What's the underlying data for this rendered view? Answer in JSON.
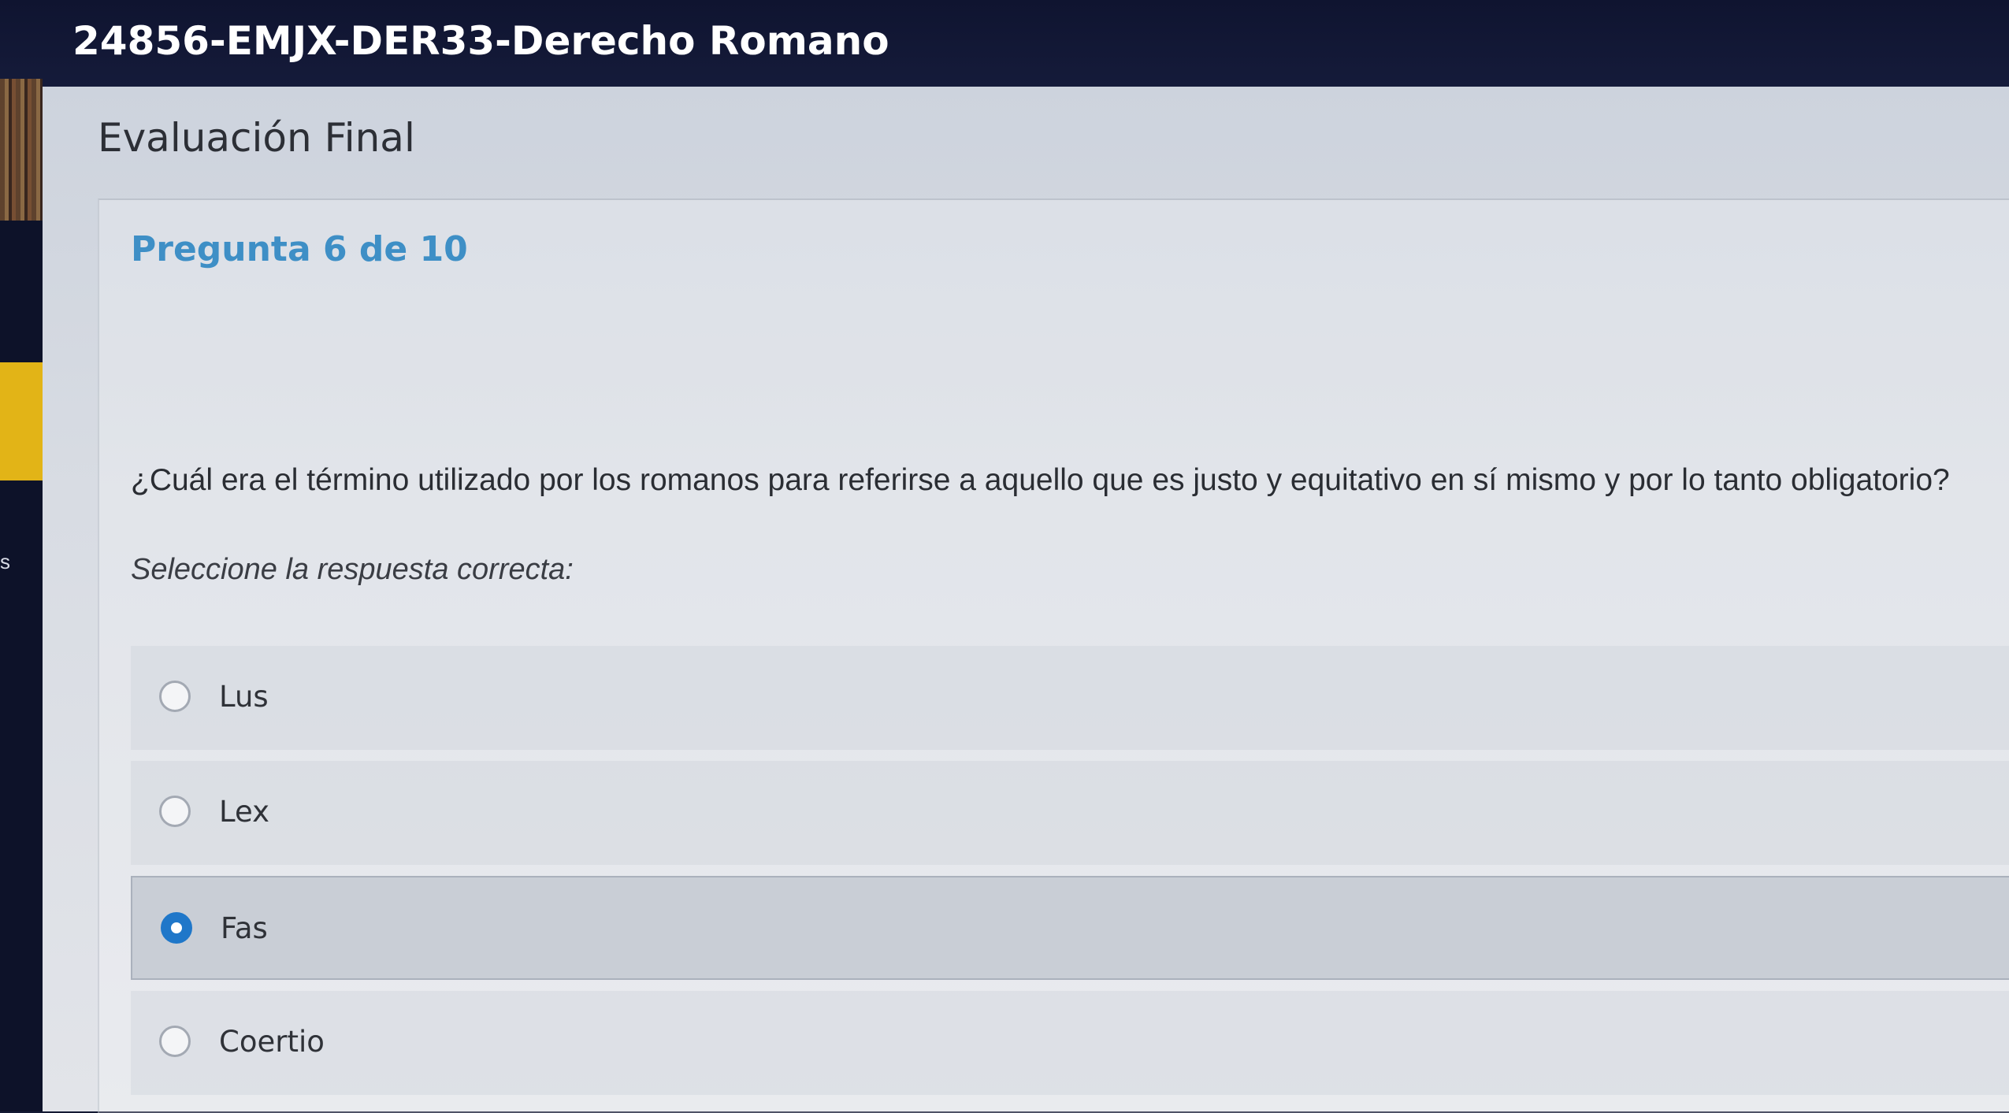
{
  "header": {
    "course_title": "24856-EMJX-DER33-Derecho Romano"
  },
  "sidebar": {
    "partial_letter": "s"
  },
  "page": {
    "section_title": "Evaluación Final"
  },
  "question": {
    "counter": "Pregunta 6 de 10",
    "text": "¿Cuál era el término utilizado por los romanos para referirse a aquello que es justo y equitativo en sí mismo y por lo tanto obligatorio?",
    "instruction": "Seleccione la respuesta correcta:",
    "selected_index": 2,
    "options": [
      {
        "label": "Lus"
      },
      {
        "label": "Lex"
      },
      {
        "label": "Fas"
      },
      {
        "label": "Coertio"
      }
    ]
  },
  "colors": {
    "header_bg": "#0f1430",
    "accent_blue": "#3e8fc6",
    "radio_selected": "#1f77c9",
    "sidebar_highlight": "#e2b417"
  }
}
